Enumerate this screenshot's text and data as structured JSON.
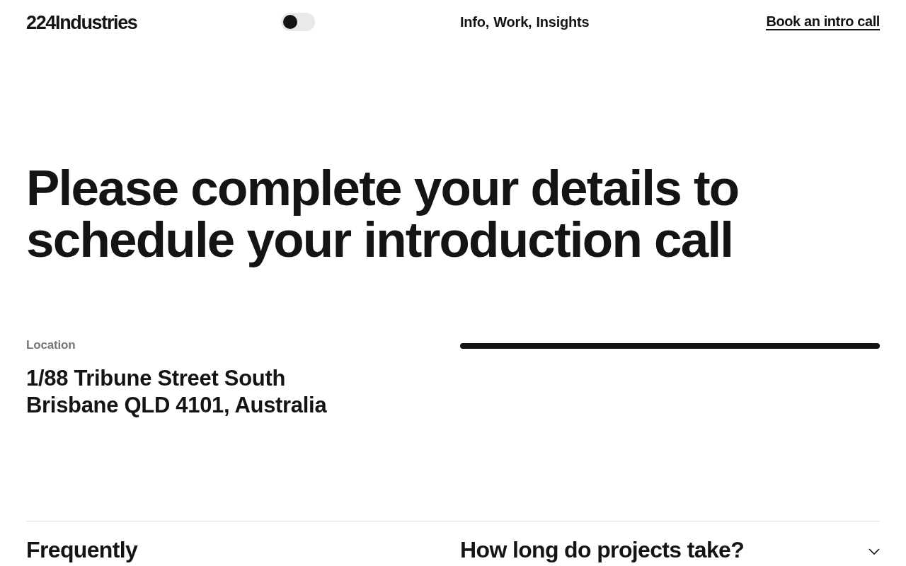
{
  "header": {
    "logo": "224Industries",
    "theme_toggle": {
      "on": false
    },
    "nav": [
      {
        "label": "Info,"
      },
      {
        "label": "Work,"
      },
      {
        "label": "Insights"
      }
    ],
    "cta": "Book an intro call"
  },
  "headline": "Please complete your details to schedule your introduction call",
  "location": {
    "label": "Location",
    "lines": [
      "1/88 Tribune Street South",
      "Brisbane QLD 4101, Australia"
    ]
  },
  "form_progress": {
    "level": 1
  },
  "faq": {
    "heading": "Frequently",
    "items": [
      {
        "question": "How long do projects take?",
        "expanded": false
      }
    ]
  }
}
